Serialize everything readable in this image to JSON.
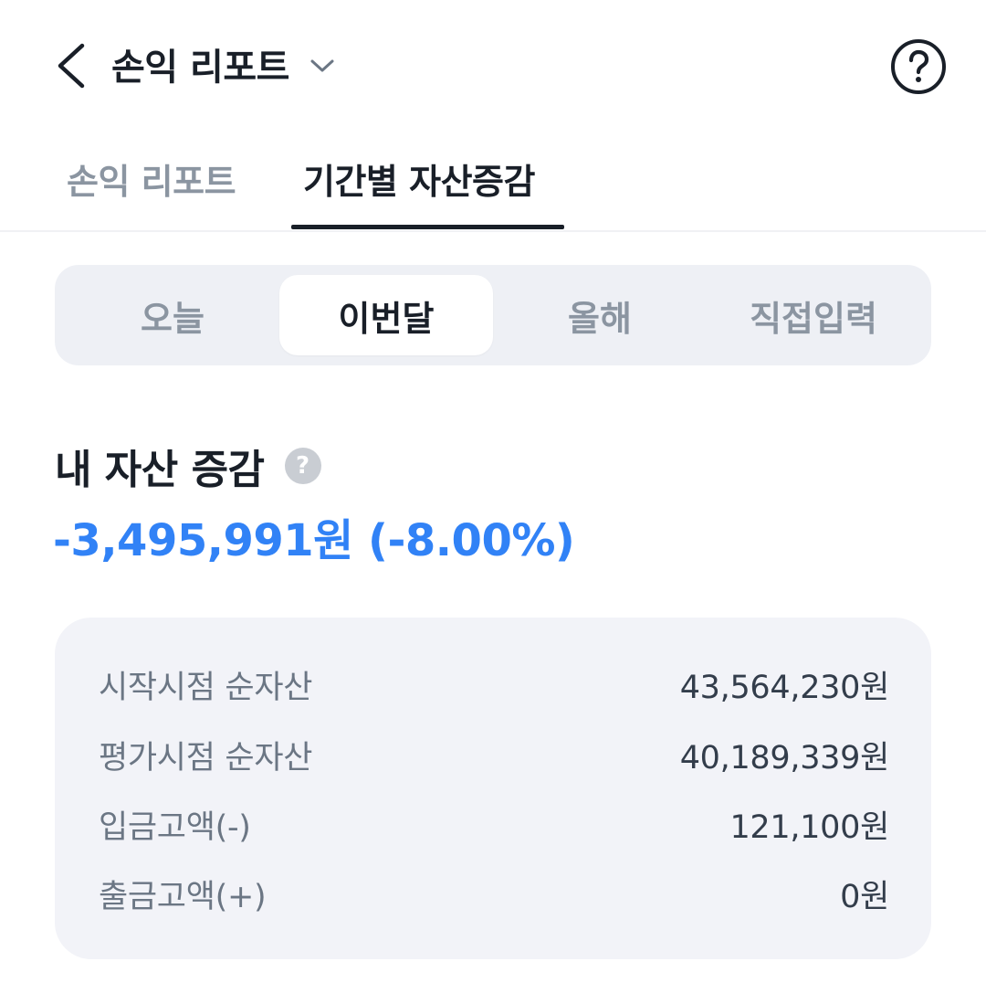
{
  "header": {
    "title": "손익 리포트",
    "back_icon": "chevron-left-icon",
    "dropdown_icon": "chevron-down-icon",
    "help_icon": "question-circle-icon"
  },
  "tabs": [
    {
      "label": "손익 리포트",
      "active": false
    },
    {
      "label": "기간별 자산증감",
      "active": true
    }
  ],
  "period_selector": {
    "options": [
      "오늘",
      "이번달",
      "올해",
      "직접입력"
    ],
    "selected": "이번달"
  },
  "summary": {
    "title": "내 자산 증감",
    "help_glyph": "?",
    "value": "-3,495,991원 (-8.00%)",
    "value_color": "#3182f6"
  },
  "details": [
    {
      "label": "시작시점 순자산",
      "value": "43,564,230원"
    },
    {
      "label": "평가시점 순자산",
      "value": "40,189,339원"
    },
    {
      "label": "입금고액(-)",
      "value": "121,100원"
    },
    {
      "label": "출금고액(+)",
      "value": "0원"
    }
  ],
  "colors": {
    "accent_blue": "#3182f6",
    "text_primary": "#191f28",
    "text_secondary": "#8b95a1",
    "card_bg": "#f2f3f8"
  }
}
